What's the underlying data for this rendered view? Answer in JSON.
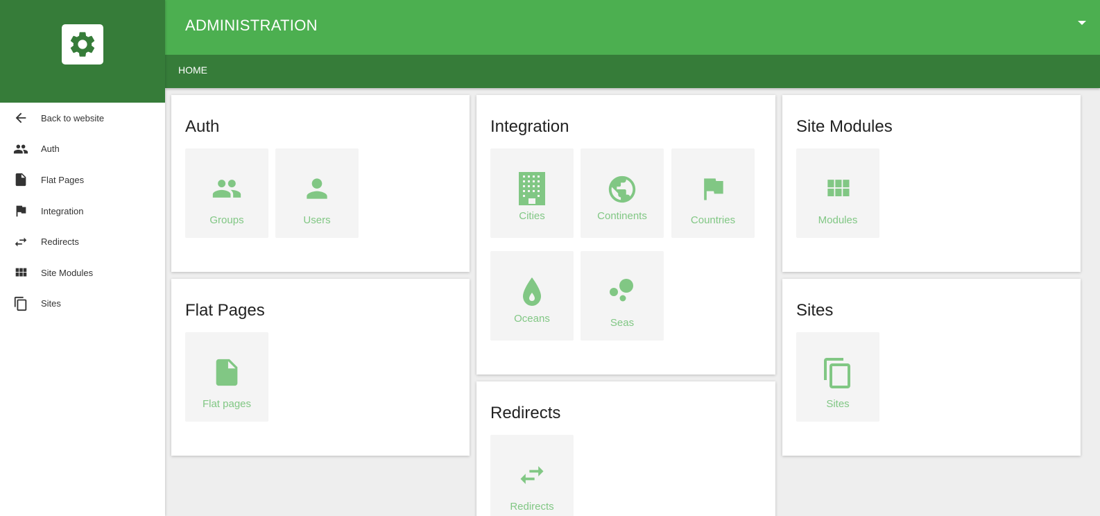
{
  "header": {
    "title": "ADMINISTRATION"
  },
  "breadcrumb": {
    "home": "HOME"
  },
  "sidebar": {
    "items": [
      {
        "label": "Back to website",
        "icon": "arrow-back-icon"
      },
      {
        "label": "Auth",
        "icon": "people-icon"
      },
      {
        "label": "Flat Pages",
        "icon": "file-icon"
      },
      {
        "label": "Integration",
        "icon": "flag-icon"
      },
      {
        "label": "Redirects",
        "icon": "swap-icon"
      },
      {
        "label": "Site Modules",
        "icon": "grid-icon"
      },
      {
        "label": "Sites",
        "icon": "copy-icon"
      }
    ]
  },
  "cards": {
    "auth": {
      "title": "Auth",
      "tiles": [
        {
          "label": "Groups",
          "icon": "people-icon"
        },
        {
          "label": "Users",
          "icon": "person-icon"
        }
      ]
    },
    "integration": {
      "title": "Integration",
      "tiles": [
        {
          "label": "Cities",
          "icon": "building-icon"
        },
        {
          "label": "Continents",
          "icon": "globe-icon"
        },
        {
          "label": "Countries",
          "icon": "flag-icon"
        },
        {
          "label": "Oceans",
          "icon": "drop-icon"
        },
        {
          "label": "Seas",
          "icon": "bubbles-icon"
        }
      ]
    },
    "site_modules": {
      "title": "Site Modules",
      "tiles": [
        {
          "label": "Modules",
          "icon": "grid-icon"
        }
      ]
    },
    "flat_pages": {
      "title": "Flat Pages",
      "tiles": [
        {
          "label": "Flat pages",
          "icon": "file-icon"
        }
      ]
    },
    "sites": {
      "title": "Sites",
      "tiles": [
        {
          "label": "Sites",
          "icon": "copy-icon"
        }
      ]
    },
    "redirects": {
      "title": "Redirects",
      "tiles": [
        {
          "label": "Redirects",
          "icon": "swap-icon"
        }
      ]
    }
  },
  "colors": {
    "primary": "#4caf50",
    "primary_dark": "#367c39",
    "tile_accent": "#81c784",
    "background": "#eeeeee"
  }
}
